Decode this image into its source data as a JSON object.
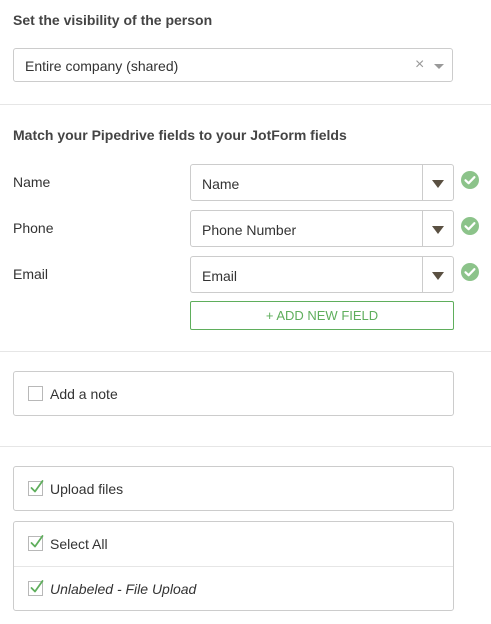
{
  "visibility": {
    "title": "Set the visibility of the person",
    "selected": "Entire company (shared)",
    "clear_symbol": "×"
  },
  "mapping": {
    "title": "Match your Pipedrive fields to your JotForm fields",
    "rows": [
      {
        "label": "Name",
        "value": "Name",
        "status": "check-icon"
      },
      {
        "label": "Phone",
        "value": "Phone Number",
        "status": "check-icon"
      },
      {
        "label": "Email",
        "value": "Email",
        "status": "check-icon"
      }
    ],
    "add_field_label": "+ ADD NEW FIELD"
  },
  "note": {
    "label": "Add a note",
    "checked": false
  },
  "upload": {
    "label": "Upload files",
    "checked": true
  },
  "files": {
    "items": [
      {
        "label": "Select All",
        "checked": true,
        "italic": false
      },
      {
        "label": "Unlabeled - File Upload",
        "checked": true,
        "italic": true
      }
    ]
  },
  "colors": {
    "accent_green": "#5fae5c",
    "check_circle": "#8cc38a",
    "caret": "#5a5042",
    "border": "#cccccc"
  }
}
